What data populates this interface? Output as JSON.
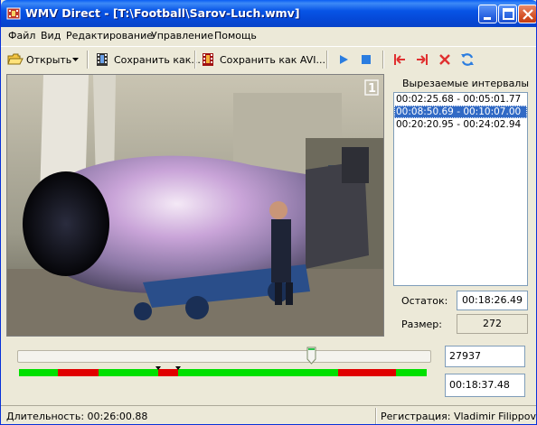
{
  "window": {
    "title": "WMV Direct - [T:\\Football\\Sarov-Luch.wmv]",
    "icon": "film-icon"
  },
  "menu": [
    "Файл",
    "Вид",
    "Редактирование",
    "Управление",
    "Помощь"
  ],
  "toolbar": {
    "open_label": "Открыть",
    "save_as_label": "Сохранить как...",
    "save_as_avi_label": "Сохранить как AVI...",
    "icons": [
      "open-folder-icon",
      "dropdown-arrow-icon",
      "save-film-icon",
      "save-avi-icon",
      "play-icon",
      "stop-icon",
      "mark-start-icon",
      "mark-end-icon",
      "delete-icon",
      "refresh-icon"
    ]
  },
  "video": {
    "description_icon": "video-frame-icon",
    "channel_logo": "1"
  },
  "intervals": {
    "header": "Вырезаемые интервалы",
    "items": [
      "00:02:25.68 - 00:05:01.77",
      "00:08:50.69 - 00:10:07.00",
      "00:20:20.95 - 00:24:02.94"
    ],
    "selected_index": 1
  },
  "stats": {
    "remaining_label": "Остаток:",
    "remaining_value": "00:18:26.49",
    "size_label": "Размер:",
    "size_value": "272"
  },
  "position": {
    "frame_value": "27937",
    "time_value": "00:18:37.48",
    "slider_fraction": 0.716
  },
  "timeline": {
    "total_seconds": 1560.88,
    "cut_color": "#e00000",
    "keep_color": "#00e000"
  },
  "status": {
    "duration": "Длительность: 00:26:00.88",
    "registration": "Регистрация: Vladimir Filippov"
  }
}
